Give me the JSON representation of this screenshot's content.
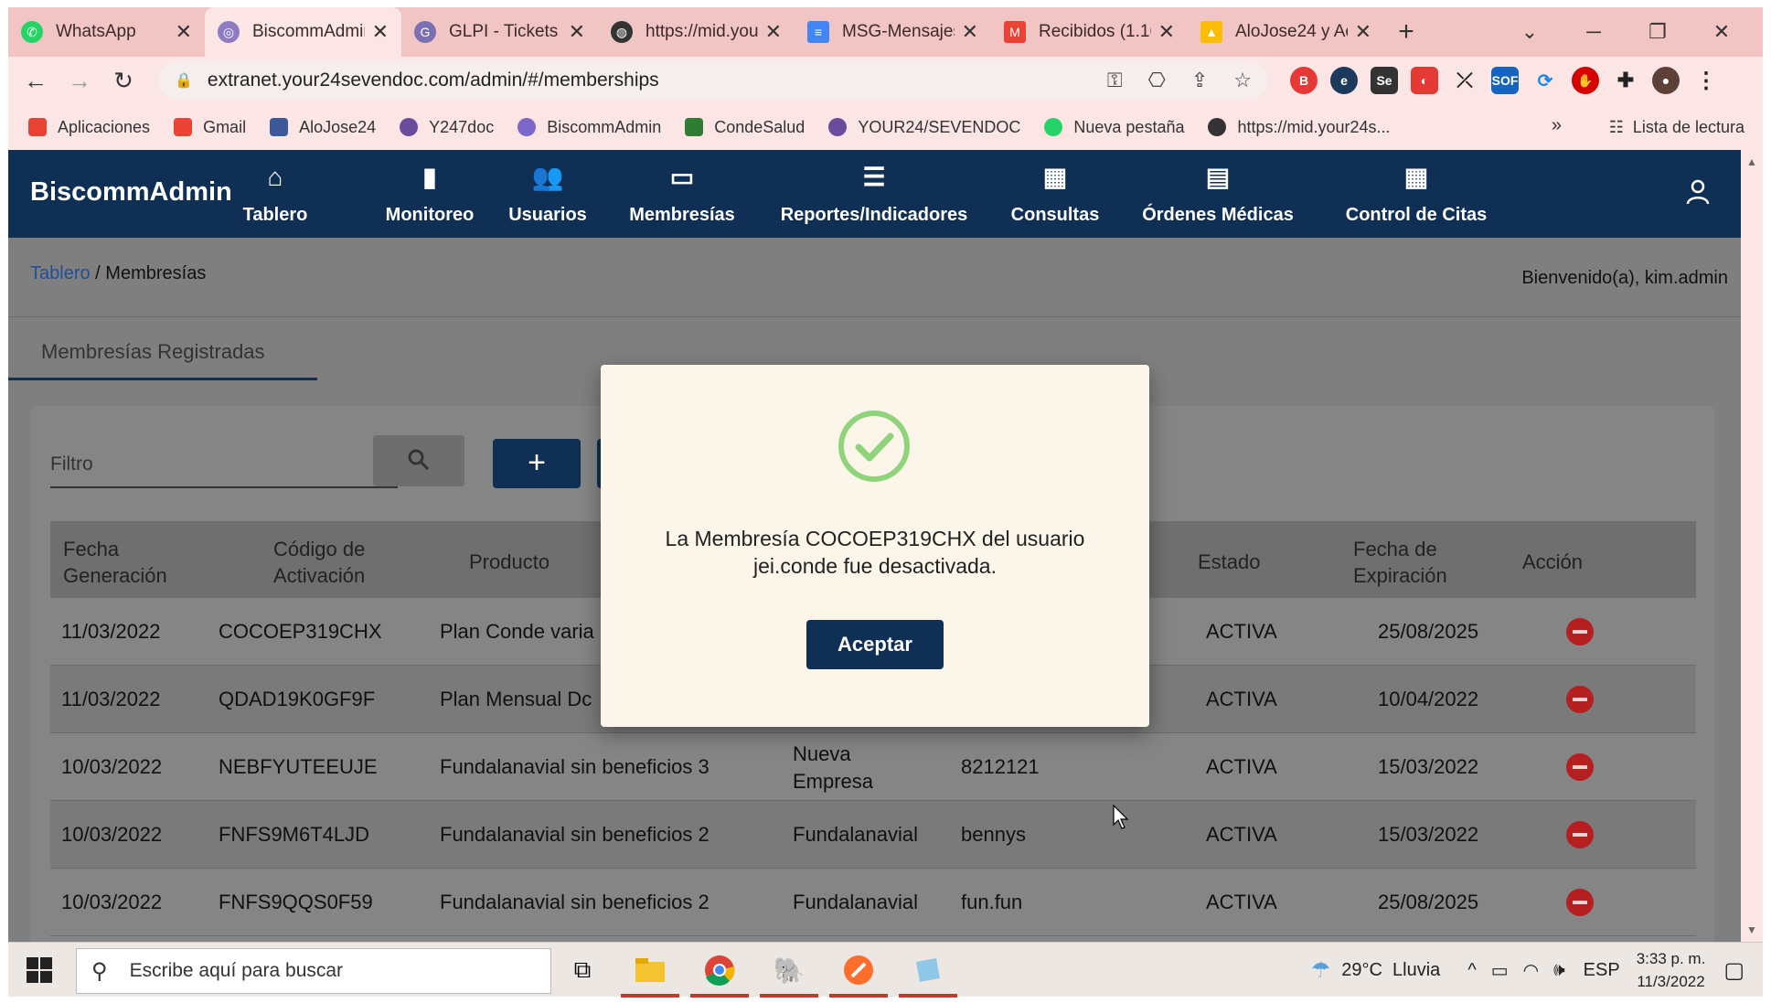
{
  "browser": {
    "tabs": [
      {
        "title": "WhatsApp",
        "icon": "whatsapp-icon",
        "active": false
      },
      {
        "title": "BiscommAdmin",
        "icon": "biscomm-icon",
        "active": true
      },
      {
        "title": "GLPI - Tickets",
        "icon": "glpi-icon",
        "active": false
      },
      {
        "title": "https://mid.you",
        "icon": "globe-icon",
        "active": false
      },
      {
        "title": "MSG-Mensajes",
        "icon": "docs-icon",
        "active": false
      },
      {
        "title": "Recibidos (1.16",
        "icon": "gmail-icon",
        "active": false
      },
      {
        "title": "AloJose24 y Ac",
        "icon": "drive-icon",
        "active": false
      }
    ],
    "url": "extranet.your24sevendoc.com/admin/#/memberships",
    "bookmarks": [
      {
        "label": "Aplicaciones",
        "color": "#e94235"
      },
      {
        "label": "Gmail",
        "color": "#ea4335"
      },
      {
        "label": "AloJose24",
        "color": "#3b5998"
      },
      {
        "label": "Y247doc",
        "color": "#6a4c9c"
      },
      {
        "label": "BiscommAdmin",
        "color": "#7b68c9"
      },
      {
        "label": "CondeSalud",
        "color": "#2e7d32"
      },
      {
        "label": "YOUR24/SEVENDOC",
        "color": "#6a4c9c"
      },
      {
        "label": "Nueva pestaña",
        "color": "#25d366"
      },
      {
        "label": "https://mid.your24s...",
        "color": "#333333"
      }
    ],
    "reading_list": "Lista de lectura",
    "overflow": "»"
  },
  "app": {
    "brand": "BiscommAdmin",
    "nav": [
      {
        "label": "Tablero",
        "icon": "home-icon",
        "glyph": "⌂"
      },
      {
        "label": "Monitoreo",
        "icon": "bar-chart-icon",
        "glyph": "▮"
      },
      {
        "label": "Usuarios",
        "icon": "people-icon",
        "glyph": "👥"
      },
      {
        "label": "Membresías",
        "icon": "card-icon",
        "glyph": "▭"
      },
      {
        "label": "Reportes/Indicadores",
        "icon": "list-icon",
        "glyph": "☰"
      },
      {
        "label": "Consultas",
        "icon": "calendar-icon",
        "glyph": "▦"
      },
      {
        "label": "Órdenes Médicas",
        "icon": "clipboard-icon",
        "glyph": "▤"
      },
      {
        "label": "Control de Citas",
        "icon": "calendar-icon",
        "glyph": "▦"
      }
    ],
    "breadcrumb": {
      "link": "Tablero",
      "sep": "/",
      "current": "Membresías"
    },
    "welcome": "Bienvenido(a), kim.admin",
    "section_tab": "Membresías Registradas",
    "filter_placeholder": "Filtro",
    "add_label": "+",
    "table": {
      "headers": [
        "Fecha Generación",
        "Código de Activación",
        "Producto",
        "",
        "",
        "Estado",
        "Fecha de Expiración",
        "Acción"
      ],
      "rows": [
        {
          "fecha": "11/03/2022",
          "codigo": "COCOEP319CHX",
          "producto": "Plan Conde varia",
          "empresa": "",
          "usuario": "",
          "estado": "ACTIVA",
          "expira": "25/08/2025"
        },
        {
          "fecha": "11/03/2022",
          "codigo": "QDAD19K0GF9F",
          "producto": "Plan Mensual Dc",
          "empresa": "",
          "usuario": "",
          "estado": "ACTIVA",
          "expira": "10/04/2022"
        },
        {
          "fecha": "10/03/2022",
          "codigo": "NEBFYUTEEUJE",
          "producto": "Fundalanavial sin beneficios 3",
          "empresa": "Nueva Empresa",
          "usuario": "8212121",
          "estado": "ACTIVA",
          "expira": "15/03/2022"
        },
        {
          "fecha": "10/03/2022",
          "codigo": "FNFS9M6T4LJD",
          "producto": "Fundalanavial sin beneficios 2",
          "empresa": "Fundalanavial",
          "usuario": "bennys",
          "estado": "ACTIVA",
          "expira": "15/03/2022"
        },
        {
          "fecha": "10/03/2022",
          "codigo": "FNFS9QQS0F59",
          "producto": "Fundalanavial sin beneficios 2",
          "empresa": "Fundalanavial",
          "usuario": "fun.fun",
          "estado": "ACTIVA",
          "expira": "25/08/2025"
        }
      ]
    }
  },
  "modal": {
    "message": "La Membresía COCOEP319CHX del usuario jei.conde fue desactivada.",
    "button": "Aceptar",
    "icon": "check-circle-icon",
    "accent": "#8fd37a"
  },
  "taskbar": {
    "search_placeholder": "Escribe aquí para buscar",
    "weather": "29°C  Lluvia",
    "language": "ESP",
    "time": "3:33 p. m.",
    "date": "11/3/2022"
  },
  "colors": {
    "primary": "#0f2f55",
    "danger": "#b51f1f",
    "chrome": "#fbe5e5"
  }
}
